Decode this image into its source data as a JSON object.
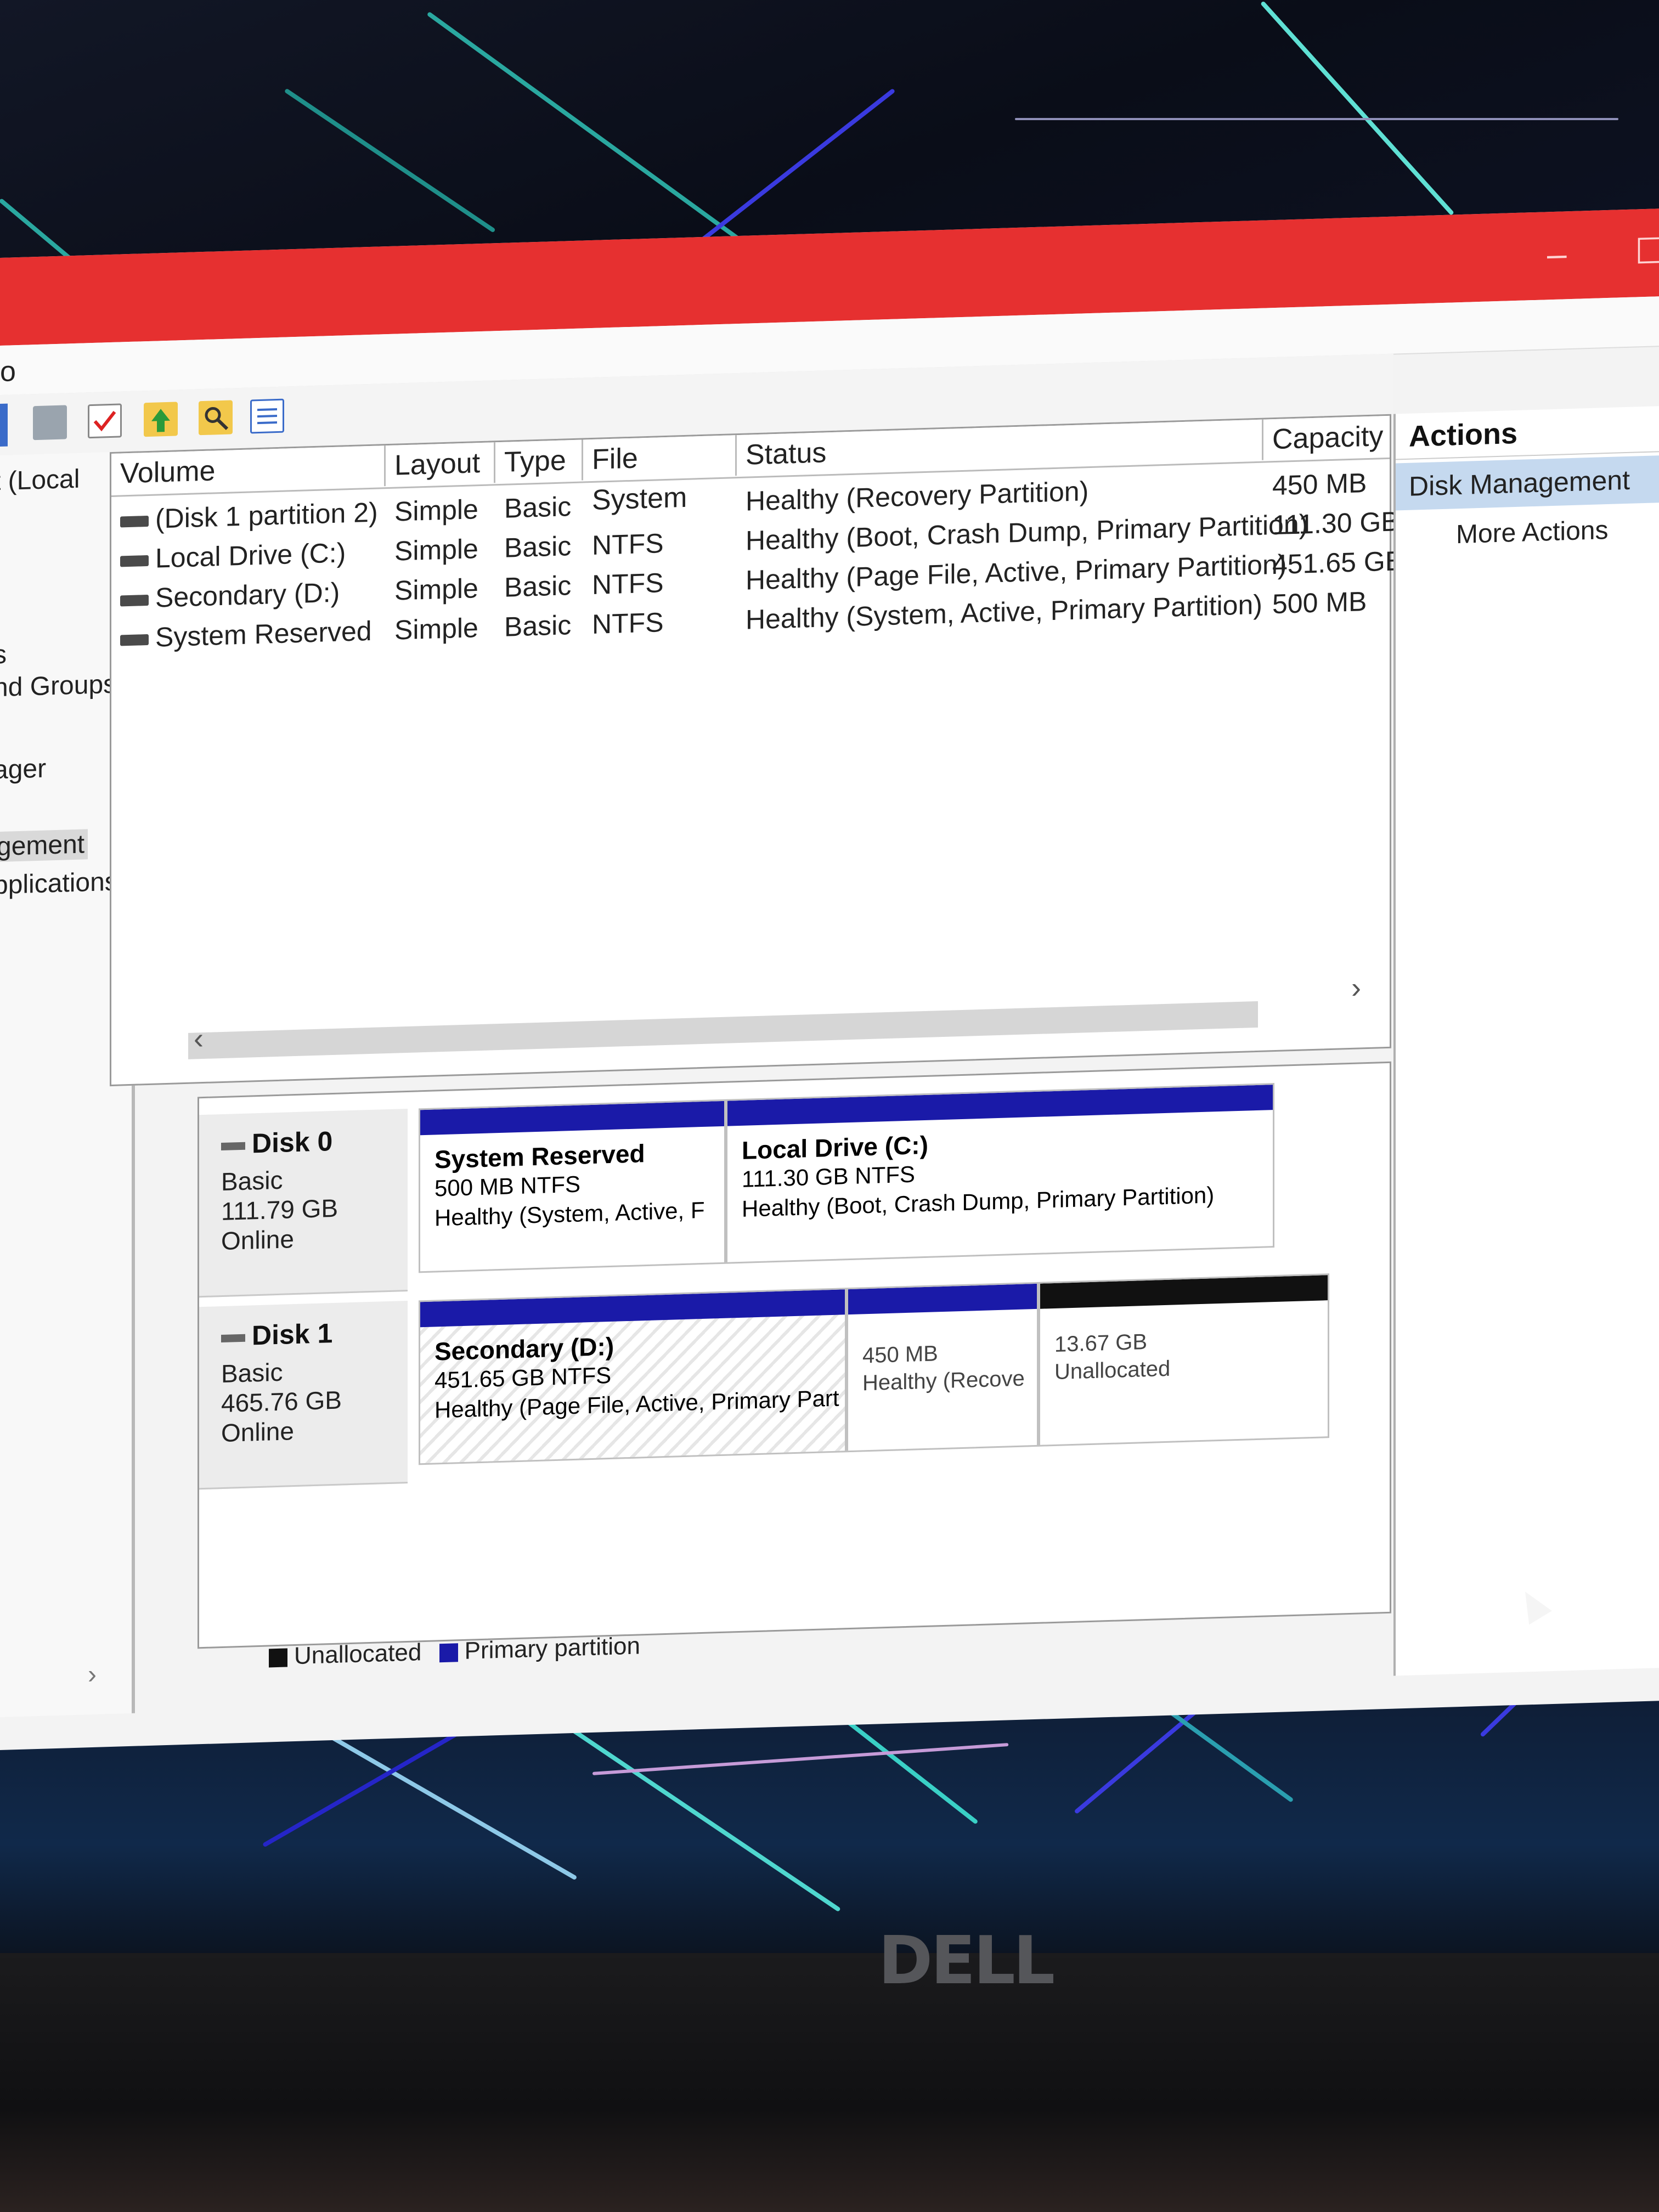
{
  "window": {
    "menu_partial": "o",
    "controls": {
      "minimize": "–",
      "maximize": "☐"
    }
  },
  "toolbar": {
    "icons": [
      "help-icon",
      "connect-icon",
      "properties-icon",
      "up-folder-icon",
      "search-folder-icon",
      "list-view-icon"
    ]
  },
  "left_tree": {
    "items": [
      "t (Local",
      "s",
      "nd Groups",
      "ager",
      "gement",
      "pplications"
    ],
    "selected": "gement"
  },
  "volume_list": {
    "columns": [
      "Volume",
      "Layout",
      "Type",
      "File System",
      "Status",
      "Capacity"
    ],
    "rows": [
      {
        "volume": "(Disk 1 partition 2)",
        "layout": "Simple",
        "type": "Basic",
        "fs": "",
        "status": "Healthy (Recovery Partition)",
        "capacity": "450 MB"
      },
      {
        "volume": "Local Drive (C:)",
        "layout": "Simple",
        "type": "Basic",
        "fs": "NTFS",
        "status": "Healthy (Boot, Crash Dump, Primary Partition)",
        "capacity": "111.30 GB"
      },
      {
        "volume": "Secondary (D:)",
        "layout": "Simple",
        "type": "Basic",
        "fs": "NTFS",
        "status": "Healthy (Page File, Active, Primary Partition)",
        "capacity": "451.65 GB"
      },
      {
        "volume": "System Reserved",
        "layout": "Simple",
        "type": "Basic",
        "fs": "NTFS",
        "status": "Healthy (System, Active, Primary Partition)",
        "capacity": "500 MB"
      }
    ],
    "scroll_left": "‹",
    "scroll_right": "›"
  },
  "actions": {
    "header": "Actions",
    "selected": "Disk Management",
    "more": "More Actions"
  },
  "disks": [
    {
      "name": "Disk 0",
      "type": "Basic",
      "size": "111.79 GB",
      "state": "Online",
      "partitions": [
        {
          "title": "System Reserved",
          "size": "500 MB NTFS",
          "status": "Healthy (System, Active, F",
          "bar_color": "#1a1aa8"
        },
        {
          "title": "Local Drive  (C:)",
          "size": "111.30 GB NTFS",
          "status": "Healthy (Boot, Crash Dump, Primary Partition)",
          "bar_color": "#1a1aa8"
        }
      ]
    },
    {
      "name": "Disk 1",
      "type": "Basic",
      "size": "465.76 GB",
      "state": "Online",
      "partitions": [
        {
          "title": "Secondary  (D:)",
          "size": "451.65 GB NTFS",
          "status": "Healthy (Page File, Active, Primary Part",
          "bar_color": "#1a1aa8"
        },
        {
          "title": "",
          "size": "450 MB",
          "status": "Healthy (Recove",
          "bar_color": "#1a1aa8"
        },
        {
          "title": "",
          "size": "13.67 GB",
          "status": "Unallocated",
          "bar_color": "#111111"
        }
      ]
    }
  ],
  "legend": {
    "unallocated": "Unallocated",
    "primary": "Primary partition",
    "scroll_right": "›"
  },
  "colors": {
    "title_bar": "#e63030",
    "primary_partition": "#1a1aa8",
    "unallocated": "#111111",
    "actions_selected": "#c5d9ef"
  },
  "bezel_logo": "DELL"
}
